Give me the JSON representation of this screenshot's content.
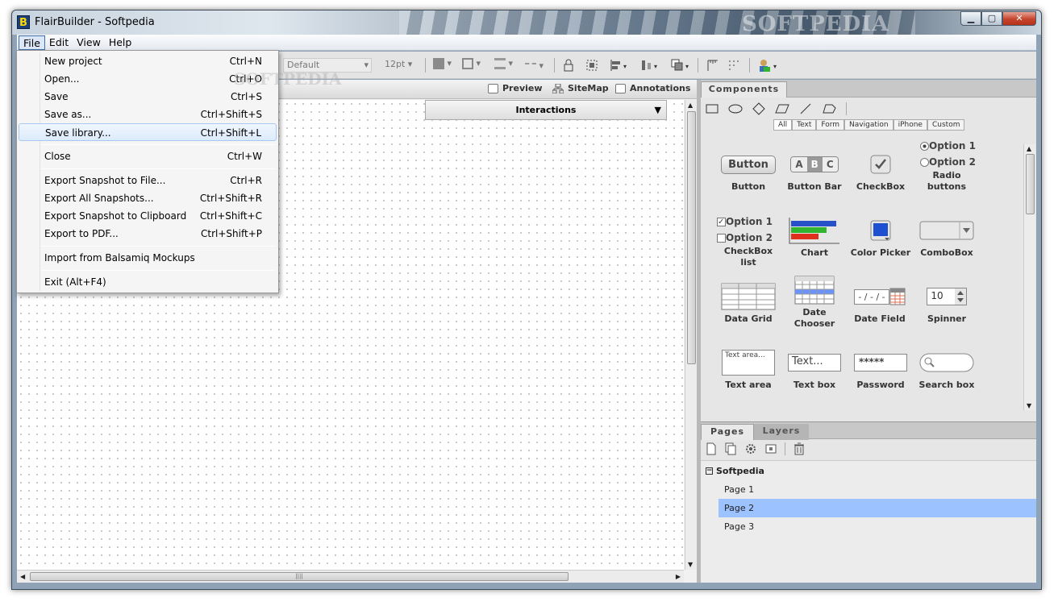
{
  "window": {
    "title": "FlairBuilder - Softpedia",
    "logo_letter": "B",
    "watermark": "SOFTPEDIA"
  },
  "window_buttons": {
    "minimize": "▁",
    "maximize": "▢",
    "close": "✕"
  },
  "menubar": {
    "items": [
      "File",
      "Edit",
      "View",
      "Help"
    ]
  },
  "file_menu": {
    "items": [
      {
        "label": "New project",
        "shortcut": "Ctrl+N"
      },
      {
        "label": "Open...",
        "shortcut": "Ctrl+O"
      },
      {
        "label": "Save",
        "shortcut": "Ctrl+S"
      },
      {
        "label": "Save as...",
        "shortcut": "Ctrl+Shift+S"
      },
      {
        "label": "Save library...",
        "shortcut": "Ctrl+Shift+L"
      },
      {
        "label": "Close",
        "shortcut": "Ctrl+W"
      },
      {
        "label": "Export Snapshot to File...",
        "shortcut": "Ctrl+R"
      },
      {
        "label": "Export All Snapshots...",
        "shortcut": "Ctrl+Shift+R"
      },
      {
        "label": "Export Snapshot to Clipboard",
        "shortcut": "Ctrl+Shift+C"
      },
      {
        "label": "Export to PDF...",
        "shortcut": "Ctrl+Shift+P"
      },
      {
        "label": "Import from Balsamiq Mockups",
        "shortcut": ""
      },
      {
        "label": "Exit  (Alt+F4)",
        "shortcut": ""
      }
    ],
    "highlighted_index": 4
  },
  "toolbar": {
    "font": "Default",
    "font_size": "12pt"
  },
  "canvas_tabs": {
    "preview": "Preview",
    "sitemap": "SiteMap",
    "annotations": "Annotations"
  },
  "interactions": {
    "label": "Interactions"
  },
  "canvas_watermark": "SOFTPEDIA",
  "components": {
    "tab": "Components",
    "categories": [
      "All",
      "Text",
      "Form",
      "Navigation",
      "iPhone",
      "Custom"
    ],
    "active_category": "All",
    "items": [
      {
        "label": "Button",
        "preview_text": "Button"
      },
      {
        "label": "Button Bar",
        "preview_text": [
          "A",
          "B",
          "C"
        ]
      },
      {
        "label": "CheckBox"
      },
      {
        "label": "Radio buttons",
        "preview_text": [
          "Option 1",
          "Option 2"
        ]
      },
      {
        "label": "CheckBox list",
        "preview_text": [
          "Option 1",
          "Option 2"
        ]
      },
      {
        "label": "Chart"
      },
      {
        "label": "Color Picker"
      },
      {
        "label": "ComboBox"
      },
      {
        "label": "Data Grid"
      },
      {
        "label": "Date Chooser"
      },
      {
        "label": "Date Field",
        "preview_text": "- / - / -"
      },
      {
        "label": "Spinner",
        "preview_text": "10"
      },
      {
        "label": "Text area",
        "preview_text": "Text area..."
      },
      {
        "label": "Text box",
        "preview_text": "Text..."
      },
      {
        "label": "Password",
        "preview_text": "*****"
      },
      {
        "label": "Search box"
      }
    ]
  },
  "pages_panel": {
    "tabs": [
      "Pages",
      "Layers"
    ],
    "project": "Softpedia",
    "pages": [
      "Page 1",
      "Page 2",
      "Page 3"
    ],
    "selected_page": "Page 2"
  },
  "colors": {
    "selection": "#9cc2ff",
    "menu_highlight": "#dcebfc",
    "chart_blue": "#2850c8",
    "chart_green": "#2fb52f",
    "chart_red": "#e0301e"
  }
}
